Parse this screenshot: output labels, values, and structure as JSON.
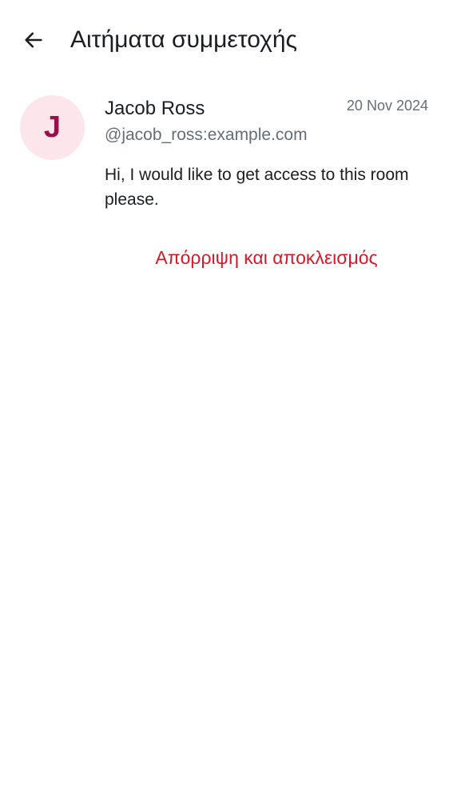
{
  "header": {
    "back_icon": "arrow-left-icon",
    "title": "Αιτήματα συμμετοχής"
  },
  "request": {
    "avatar_letter": "J",
    "avatar_bg": "#fde5ec",
    "avatar_fg": "#9b0f48",
    "name": "Jacob Ross",
    "user_id": "@jacob_ross:example.com",
    "date": "20 Nov 2024",
    "message": "Hi, I would like to get access to this room please.",
    "decline_label": "Απόρριψη και αποκλεισμός",
    "decline_color": "#d51928"
  }
}
